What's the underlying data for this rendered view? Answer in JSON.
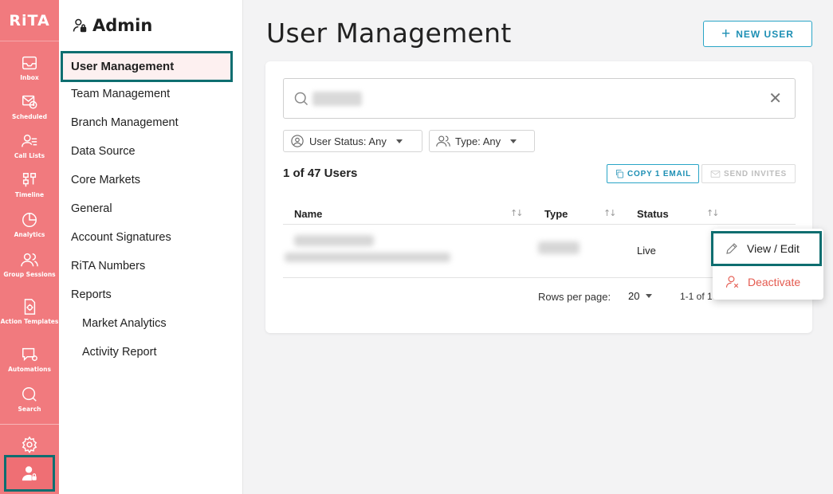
{
  "app": {
    "logo": "RiTA"
  },
  "rail": {
    "items": [
      {
        "label": "Inbox",
        "icon": "inbox-icon"
      },
      {
        "label": "Scheduled",
        "icon": "scheduled-icon"
      },
      {
        "label": "Call Lists",
        "icon": "call-list-icon"
      },
      {
        "label": "Timeline",
        "icon": "timeline-icon"
      },
      {
        "label": "Analytics",
        "icon": "analytics-icon"
      },
      {
        "label": "Group Sessions",
        "icon": "group-sessions-icon"
      },
      {
        "label": "Action Templates",
        "icon": "action-templates-icon"
      },
      {
        "label": "Automations",
        "icon": "automations-icon"
      },
      {
        "label": "Search",
        "icon": "search-icon"
      }
    ],
    "settings_icon": "gear-icon",
    "admin_icon": "admin-user-icon"
  },
  "sidebar": {
    "title": "Admin",
    "items": [
      {
        "label": "User Management",
        "active": true
      },
      {
        "label": "Team Management"
      },
      {
        "label": "Branch Management"
      },
      {
        "label": "Data Source"
      },
      {
        "label": "Core Markets"
      },
      {
        "label": "General"
      },
      {
        "label": "Account Signatures"
      },
      {
        "label": "RiTA Numbers"
      },
      {
        "label": "Reports"
      },
      {
        "label": "Market Analytics",
        "sub": true
      },
      {
        "label": "Activity Report",
        "sub": true
      }
    ]
  },
  "main": {
    "title": "User Management",
    "new_user_label": "NEW USER",
    "search": {
      "placeholder": ""
    },
    "filters": {
      "status": "User Status: Any",
      "type": "Type: Any"
    },
    "count": "1 of 47 Users",
    "copy_label": "COPY 1 EMAIL",
    "invite_label": "SEND INVITES",
    "columns": {
      "name": "Name",
      "type": "Type",
      "status": "Status"
    },
    "rows": [
      {
        "status": "Live"
      }
    ],
    "pagination": {
      "rows_per_page_label": "Rows per page:",
      "rows_per_page": "20",
      "range": "1-1 of 1"
    }
  },
  "menu": {
    "view_edit": "View / Edit",
    "deactivate": "Deactivate"
  },
  "colors": {
    "rail": "#f17a7e",
    "highlight": "#0e6e70",
    "accent": "#1d8fb4",
    "danger": "#e45a4f"
  }
}
